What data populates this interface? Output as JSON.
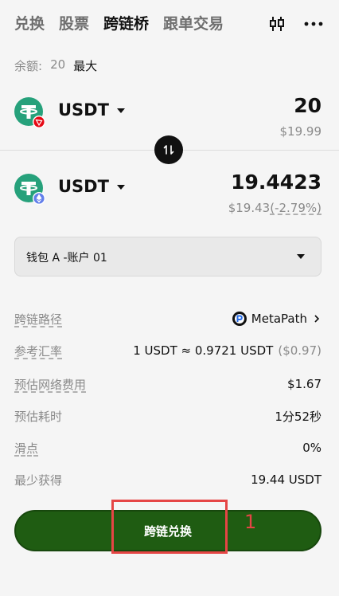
{
  "tabs": [
    {
      "label": "兑换"
    },
    {
      "label": "股票"
    },
    {
      "label": "跨链桥"
    },
    {
      "label": "跟单交易"
    }
  ],
  "icons": {
    "chart": "candlestick-icon",
    "more": "more-icon"
  },
  "balance": {
    "label": "余额:",
    "value": "20",
    "max": "最大"
  },
  "from": {
    "token": "USDT",
    "amount": "20",
    "fiat": "$19.99",
    "network_badge": "tron"
  },
  "to": {
    "token": "USDT",
    "amount": "19.4423",
    "fiat": "$19.43",
    "change": "(-2.79%)",
    "network_badge": "ethereum"
  },
  "wallet": {
    "label": "钱包 A -账户 01"
  },
  "details": {
    "route": {
      "label": "跨链路径",
      "value": "MetaPath"
    },
    "rate": {
      "label": "参考汇率",
      "value": "1 USDT ≈ 0.9721 USDT",
      "fiat": "($0.97)"
    },
    "fee": {
      "label": "预估网络费用",
      "value": "$1.67"
    },
    "time": {
      "label": "预估耗时",
      "value": "1分52秒"
    },
    "slippage": {
      "label": "滑点",
      "value": "0%"
    },
    "minimum": {
      "label": "最少获得",
      "value": "19.44 USDT"
    }
  },
  "cta": {
    "label": "跨链兑换"
  },
  "annotation": {
    "number": "1"
  },
  "colors": {
    "accent": "#1f5c12",
    "tether": "#26a17b",
    "tron": "#e50915",
    "eth": "#627eea",
    "annotation": "#e54545"
  }
}
